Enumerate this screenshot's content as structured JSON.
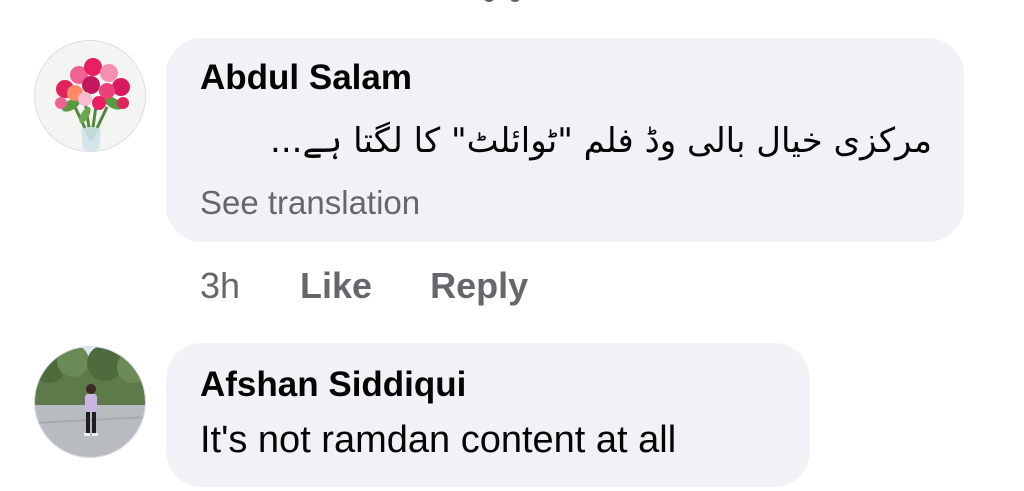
{
  "comments": [
    {
      "author": "Abdul Salam",
      "text": "مرکزی خیال بالی وڈ فلم \"ٹوائلٹ\" کا لگتا ہے...",
      "see_translation": "See translation",
      "avatar": "flower-bouquet-avatar"
    },
    {
      "author": "Afshan Siddiqui",
      "text": "It's not ramdan content at all",
      "avatar": "person-outdoors-avatar"
    }
  ],
  "actions": {
    "time": "3h",
    "like": "Like",
    "reply": "Reply"
  },
  "colors": {
    "bubble": "#f0f2f5",
    "primary_text": "#050505",
    "secondary_text": "#65676b"
  }
}
